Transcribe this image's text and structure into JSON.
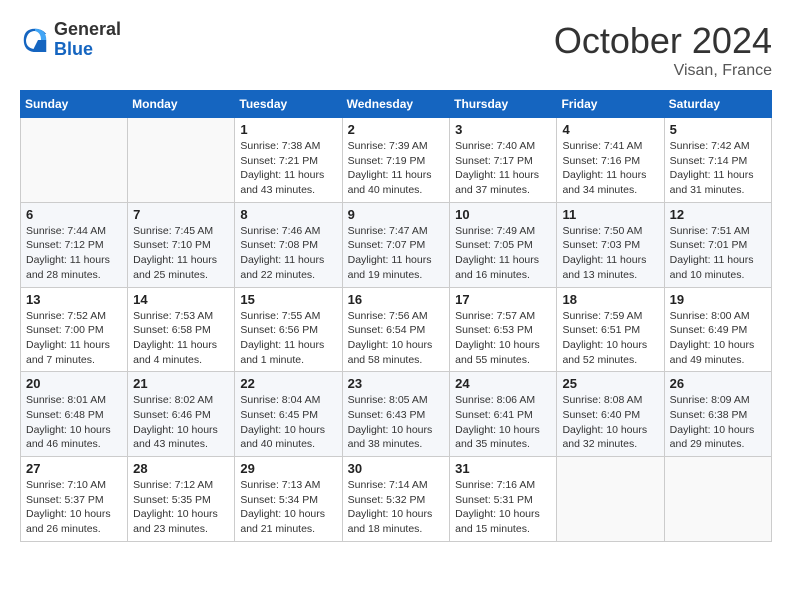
{
  "logo": {
    "general": "General",
    "blue": "Blue"
  },
  "title": "October 2024",
  "location": "Visan, France",
  "days_header": [
    "Sunday",
    "Monday",
    "Tuesday",
    "Wednesday",
    "Thursday",
    "Friday",
    "Saturday"
  ],
  "weeks": [
    [
      {
        "day": "",
        "detail": ""
      },
      {
        "day": "",
        "detail": ""
      },
      {
        "day": "1",
        "detail": "Sunrise: 7:38 AM\nSunset: 7:21 PM\nDaylight: 11 hours and 43 minutes."
      },
      {
        "day": "2",
        "detail": "Sunrise: 7:39 AM\nSunset: 7:19 PM\nDaylight: 11 hours and 40 minutes."
      },
      {
        "day": "3",
        "detail": "Sunrise: 7:40 AM\nSunset: 7:17 PM\nDaylight: 11 hours and 37 minutes."
      },
      {
        "day": "4",
        "detail": "Sunrise: 7:41 AM\nSunset: 7:16 PM\nDaylight: 11 hours and 34 minutes."
      },
      {
        "day": "5",
        "detail": "Sunrise: 7:42 AM\nSunset: 7:14 PM\nDaylight: 11 hours and 31 minutes."
      }
    ],
    [
      {
        "day": "6",
        "detail": "Sunrise: 7:44 AM\nSunset: 7:12 PM\nDaylight: 11 hours and 28 minutes."
      },
      {
        "day": "7",
        "detail": "Sunrise: 7:45 AM\nSunset: 7:10 PM\nDaylight: 11 hours and 25 minutes."
      },
      {
        "day": "8",
        "detail": "Sunrise: 7:46 AM\nSunset: 7:08 PM\nDaylight: 11 hours and 22 minutes."
      },
      {
        "day": "9",
        "detail": "Sunrise: 7:47 AM\nSunset: 7:07 PM\nDaylight: 11 hours and 19 minutes."
      },
      {
        "day": "10",
        "detail": "Sunrise: 7:49 AM\nSunset: 7:05 PM\nDaylight: 11 hours and 16 minutes."
      },
      {
        "day": "11",
        "detail": "Sunrise: 7:50 AM\nSunset: 7:03 PM\nDaylight: 11 hours and 13 minutes."
      },
      {
        "day": "12",
        "detail": "Sunrise: 7:51 AM\nSunset: 7:01 PM\nDaylight: 11 hours and 10 minutes."
      }
    ],
    [
      {
        "day": "13",
        "detail": "Sunrise: 7:52 AM\nSunset: 7:00 PM\nDaylight: 11 hours and 7 minutes."
      },
      {
        "day": "14",
        "detail": "Sunrise: 7:53 AM\nSunset: 6:58 PM\nDaylight: 11 hours and 4 minutes."
      },
      {
        "day": "15",
        "detail": "Sunrise: 7:55 AM\nSunset: 6:56 PM\nDaylight: 11 hours and 1 minute."
      },
      {
        "day": "16",
        "detail": "Sunrise: 7:56 AM\nSunset: 6:54 PM\nDaylight: 10 hours and 58 minutes."
      },
      {
        "day": "17",
        "detail": "Sunrise: 7:57 AM\nSunset: 6:53 PM\nDaylight: 10 hours and 55 minutes."
      },
      {
        "day": "18",
        "detail": "Sunrise: 7:59 AM\nSunset: 6:51 PM\nDaylight: 10 hours and 52 minutes."
      },
      {
        "day": "19",
        "detail": "Sunrise: 8:00 AM\nSunset: 6:49 PM\nDaylight: 10 hours and 49 minutes."
      }
    ],
    [
      {
        "day": "20",
        "detail": "Sunrise: 8:01 AM\nSunset: 6:48 PM\nDaylight: 10 hours and 46 minutes."
      },
      {
        "day": "21",
        "detail": "Sunrise: 8:02 AM\nSunset: 6:46 PM\nDaylight: 10 hours and 43 minutes."
      },
      {
        "day": "22",
        "detail": "Sunrise: 8:04 AM\nSunset: 6:45 PM\nDaylight: 10 hours and 40 minutes."
      },
      {
        "day": "23",
        "detail": "Sunrise: 8:05 AM\nSunset: 6:43 PM\nDaylight: 10 hours and 38 minutes."
      },
      {
        "day": "24",
        "detail": "Sunrise: 8:06 AM\nSunset: 6:41 PM\nDaylight: 10 hours and 35 minutes."
      },
      {
        "day": "25",
        "detail": "Sunrise: 8:08 AM\nSunset: 6:40 PM\nDaylight: 10 hours and 32 minutes."
      },
      {
        "day": "26",
        "detail": "Sunrise: 8:09 AM\nSunset: 6:38 PM\nDaylight: 10 hours and 29 minutes."
      }
    ],
    [
      {
        "day": "27",
        "detail": "Sunrise: 7:10 AM\nSunset: 5:37 PM\nDaylight: 10 hours and 26 minutes."
      },
      {
        "day": "28",
        "detail": "Sunrise: 7:12 AM\nSunset: 5:35 PM\nDaylight: 10 hours and 23 minutes."
      },
      {
        "day": "29",
        "detail": "Sunrise: 7:13 AM\nSunset: 5:34 PM\nDaylight: 10 hours and 21 minutes."
      },
      {
        "day": "30",
        "detail": "Sunrise: 7:14 AM\nSunset: 5:32 PM\nDaylight: 10 hours and 18 minutes."
      },
      {
        "day": "31",
        "detail": "Sunrise: 7:16 AM\nSunset: 5:31 PM\nDaylight: 10 hours and 15 minutes."
      },
      {
        "day": "",
        "detail": ""
      },
      {
        "day": "",
        "detail": ""
      }
    ]
  ]
}
